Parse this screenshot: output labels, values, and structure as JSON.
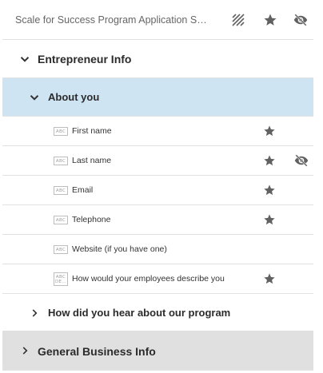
{
  "header": {
    "title": "Scale for Success Program Application Str...",
    "icons": [
      "striped-pattern-icon",
      "star-icon",
      "visibility-off-icon"
    ]
  },
  "sections": [
    {
      "label": "Entrepreneur Info",
      "expanded": true,
      "subsections": [
        {
          "label": "About you",
          "expanded": true,
          "selected": true,
          "fields": [
            {
              "type_icon": "abc-text-icon",
              "label": "First name",
              "starred": true,
              "hidden": false
            },
            {
              "type_icon": "abc-text-icon",
              "label": "Last name",
              "starred": true,
              "hidden": true
            },
            {
              "type_icon": "abc-text-icon",
              "label": "Email",
              "starred": true,
              "hidden": false
            },
            {
              "type_icon": "abc-text-icon",
              "label": "Telephone",
              "starred": true,
              "hidden": false
            },
            {
              "type_icon": "abc-text-icon",
              "label": "Website (if you have one)",
              "starred": false,
              "hidden": false
            },
            {
              "type_icon": "abc-paragraph-icon",
              "label": "How would your employees describe you",
              "starred": true,
              "hidden": false
            }
          ]
        },
        {
          "label": "How did you hear about our program",
          "expanded": false
        }
      ]
    },
    {
      "label": "General Business Info",
      "expanded": false
    }
  ],
  "type_icon_text": {
    "short": "ABC",
    "para_top": "ABC",
    "para_bottom": "DE…"
  },
  "colors": {
    "selected_bg": "#cfe4f3",
    "section_collapsed_bg": "#e0e0e0",
    "icon": "#616161"
  }
}
